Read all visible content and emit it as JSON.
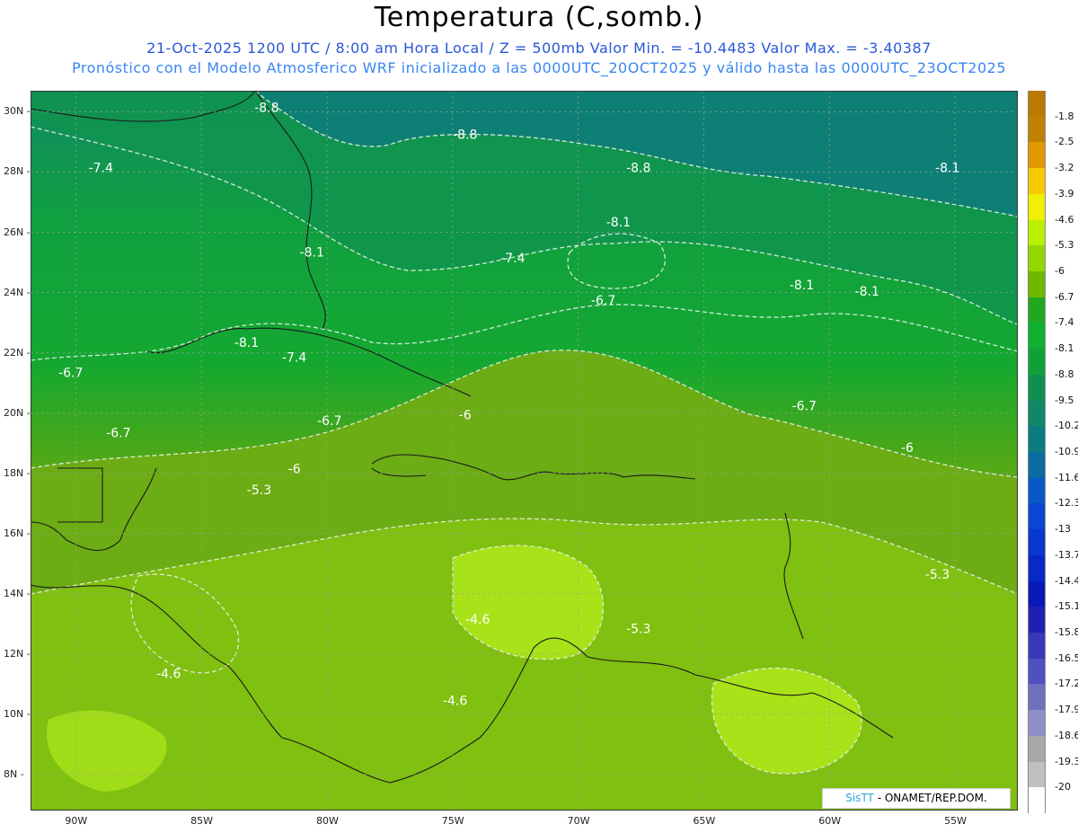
{
  "title": "Temperatura (C,somb.)",
  "subtitle1": "21-Oct-2025  1200 UTC / 8:00 am Hora Local / Z = 500mb  Valor Min. = -10.4483  Valor Max. = -3.40387",
  "subtitle2": "Pronóstico con el Modelo Atmosferico WRF inicializado a las 0000UTC_20OCT2025 y válido hasta las  0000UTC_23OCT2025",
  "credit": {
    "sis": "SisTT",
    "text": " - ONAMET/REP.DOM."
  },
  "lat_labels": [
    "30N",
    "28N",
    "26N",
    "24N",
    "22N",
    "20N",
    "18N",
    "16N",
    "14N",
    "12N",
    "10N",
    "8N"
  ],
  "lon_labels": [
    "90W",
    "85W",
    "80W",
    "75W",
    "70W",
    "65W",
    "60W",
    "55W"
  ],
  "contour_labels": [
    {
      "text": "-8.8",
      "lon": -82.4,
      "lat": 30.0
    },
    {
      "text": "-8.8",
      "lon": -74.5,
      "lat": 29.1
    },
    {
      "text": "-8.8",
      "lon": -67.6,
      "lat": 28.0
    },
    {
      "text": "-8.1",
      "lon": -55.3,
      "lat": 28.0
    },
    {
      "text": "-7.4",
      "lon": -89.0,
      "lat": 28.0
    },
    {
      "text": "-8.1",
      "lon": -68.4,
      "lat": 26.2
    },
    {
      "text": "-8.1",
      "lon": -80.6,
      "lat": 25.2
    },
    {
      "text": "-7.4",
      "lon": -72.6,
      "lat": 25.0
    },
    {
      "text": "-8.1",
      "lon": -61.1,
      "lat": 24.1
    },
    {
      "text": "-8.1",
      "lon": -58.5,
      "lat": 23.9
    },
    {
      "text": "-6.7",
      "lon": -69.0,
      "lat": 23.6
    },
    {
      "text": "-8.1",
      "lon": -83.2,
      "lat": 22.2
    },
    {
      "text": "-7.4",
      "lon": -81.3,
      "lat": 21.7
    },
    {
      "text": "-6.7",
      "lon": -90.2,
      "lat": 21.2
    },
    {
      "text": "-6.7",
      "lon": -61.0,
      "lat": 20.1
    },
    {
      "text": "-6",
      "lon": -74.5,
      "lat": 19.8
    },
    {
      "text": "-6.7",
      "lon": -79.9,
      "lat": 19.6
    },
    {
      "text": "-6.7",
      "lon": -88.3,
      "lat": 19.2
    },
    {
      "text": "-6",
      "lon": -56.9,
      "lat": 18.7
    },
    {
      "text": "-6",
      "lon": -81.3,
      "lat": 18.0
    },
    {
      "text": "-5.3",
      "lon": -82.7,
      "lat": 17.3
    },
    {
      "text": "-5.3",
      "lon": -55.7,
      "lat": 14.5
    },
    {
      "text": "-4.6",
      "lon": -74.0,
      "lat": 13.0
    },
    {
      "text": "-5.3",
      "lon": -67.6,
      "lat": 12.7
    },
    {
      "text": "-4.6",
      "lon": -86.3,
      "lat": 11.2
    },
    {
      "text": "-4.6",
      "lon": -74.9,
      "lat": 10.3
    }
  ],
  "colorbar_labels": [
    "-1.8",
    "-2.5",
    "-3.2",
    "-3.9",
    "-4.6",
    "-5.3",
    "-6",
    "-6.7",
    "-7.4",
    "-8.1",
    "-8.8",
    "-9.5",
    "-10.2",
    "-10.9",
    "-11.6",
    "-12.3",
    "-13",
    "-13.7",
    "-14.4",
    "-15.1",
    "-15.8",
    "-16.5",
    "-17.2",
    "-17.9",
    "-18.6",
    "-19.3",
    "-20"
  ],
  "colorbar_colors": [
    "#c08000",
    "#e09a00",
    "#f8c800",
    "#f0f000",
    "#b8f000",
    "#90d800",
    "#70b800",
    "#20a820",
    "#10b030",
    "#10a038",
    "#109050",
    "#108868",
    "#0c7c80",
    "#0a6ca0",
    "#0a58c8",
    "#0a46d0",
    "#0838d0",
    "#0828c8",
    "#0a18b8",
    "#2020b0",
    "#3838b8",
    "#5050c0",
    "#7070c0",
    "#9090c8",
    "#a8a8a8",
    "#c0c0c0",
    "#ffffff"
  ],
  "land_color": "#1a1a1a"
}
